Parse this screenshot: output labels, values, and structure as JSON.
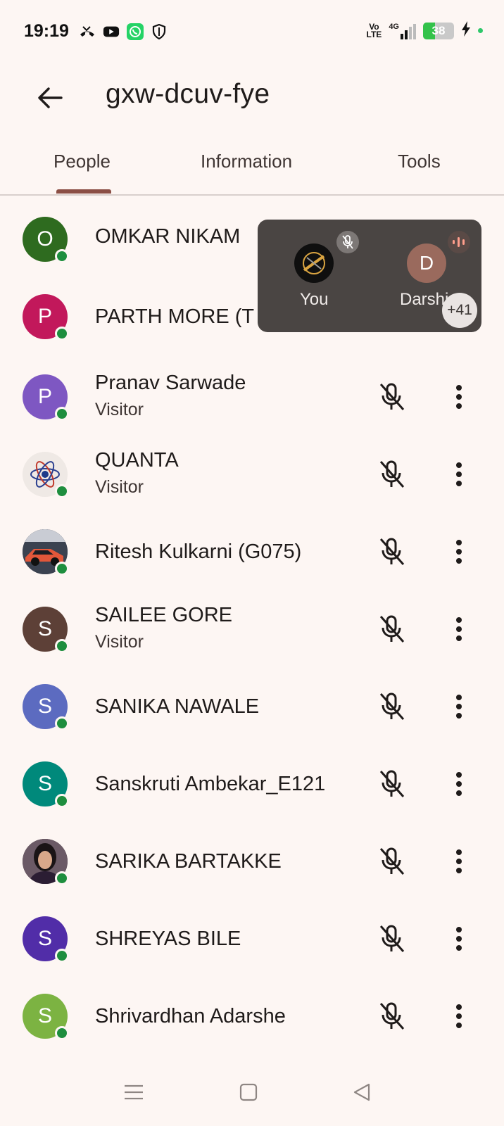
{
  "status_bar": {
    "time": "19:19",
    "left_icons": [
      "missed-call-icon",
      "youtube-icon",
      "whatsapp-icon",
      "shield-icon"
    ],
    "network_label_top": "Vo",
    "network_label_bottom": "LTE",
    "signal_type": "4G",
    "battery_level": "38"
  },
  "header": {
    "back_icon": "arrow-left-icon",
    "title": "gxw-dcuv-fye"
  },
  "tabs": [
    {
      "label": "People",
      "selected": true
    },
    {
      "label": "Information",
      "selected": false
    },
    {
      "label": "Tools",
      "selected": false
    }
  ],
  "people": [
    {
      "initial": "O",
      "name": "OMKAR NIKAM",
      "role": "",
      "color": "#2e6b1f"
    },
    {
      "initial": "P",
      "name": "PARTH MORE (T",
      "role": "",
      "color": "#c2185b"
    },
    {
      "initial": "P",
      "name": "Pranav Sarwade",
      "role": "Visitor",
      "color": "#7e57c2"
    },
    {
      "initial": "",
      "name": "QUANTA",
      "role": "Visitor",
      "color": "#f3ece8"
    },
    {
      "initial": "",
      "name": "Ritesh Kulkarni (G075)",
      "role": "",
      "color": "#3a3a4a"
    },
    {
      "initial": "S",
      "name": "SAILEE GORE",
      "role": "Visitor",
      "color": "#5d4037"
    },
    {
      "initial": "S",
      "name": "SANIKA NAWALE",
      "role": "",
      "color": "#5c6bc0"
    },
    {
      "initial": "S",
      "name": "Sanskruti Ambekar_E121",
      "role": "",
      "color": "#00897b"
    },
    {
      "initial": "",
      "name": "SARIKA BARTAKKE",
      "role": "",
      "color": "#2a1f24"
    },
    {
      "initial": "S",
      "name": "SHREYAS BILE",
      "role": "",
      "color": "#512da8"
    },
    {
      "initial": "S",
      "name": "Shrivardhan Adarshe",
      "role": "",
      "color": "#7cb342"
    }
  ],
  "floating_panel": {
    "you_label": "You",
    "other_initial": "D",
    "other_label": "Darshi",
    "more_count": "+41"
  },
  "nav_bar": {
    "menu_icon": "menu-icon",
    "home_icon": "home-square-icon",
    "back_icon": "back-triangle-icon"
  }
}
